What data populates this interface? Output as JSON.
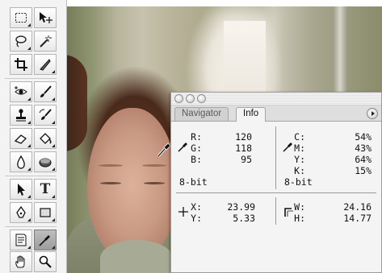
{
  "tools": [
    {
      "name": "rectangular-marquee-icon"
    },
    {
      "name": "move-icon"
    },
    {
      "name": "lasso-icon"
    },
    {
      "name": "magic-wand-icon"
    },
    {
      "name": "crop-icon"
    },
    {
      "name": "slice-icon"
    },
    {
      "name": "red-eye-icon"
    },
    {
      "name": "brush-icon"
    },
    {
      "name": "clone-stamp-icon"
    },
    {
      "name": "history-brush-icon"
    },
    {
      "name": "eraser-icon"
    },
    {
      "name": "paint-bucket-icon"
    },
    {
      "name": "blur-icon"
    },
    {
      "name": "sponge-icon"
    },
    {
      "name": "path-selection-icon"
    },
    {
      "name": "type-icon",
      "glyph": "T"
    },
    {
      "name": "pen-icon"
    },
    {
      "name": "rectangle-shape-icon"
    },
    {
      "name": "notes-icon"
    },
    {
      "name": "eyedropper-icon",
      "active": true
    },
    {
      "name": "hand-icon"
    },
    {
      "name": "zoom-icon"
    }
  ],
  "palette": {
    "tabs": {
      "navigator": "Navigator",
      "info": "Info"
    },
    "rgb": {
      "labels": [
        "R:",
        "G:",
        "B:"
      ],
      "values": [
        "120",
        "118",
        "95"
      ],
      "bit_depth": "8-bit"
    },
    "cmyk": {
      "labels": [
        "C:",
        "M:",
        "Y:",
        "K:"
      ],
      "values": [
        "54%",
        "43%",
        "64%",
        "15%"
      ],
      "bit_depth": "8-bit"
    },
    "position": {
      "labels": [
        "X:",
        "Y:"
      ],
      "values": [
        "23.99",
        "5.33"
      ]
    },
    "size": {
      "labels": [
        "W:",
        "H:"
      ],
      "values": [
        "24.16",
        "14.77"
      ]
    }
  },
  "colors": {
    "sweater_orange": "#f27a18",
    "palette_bg": "#f4f4f4"
  }
}
